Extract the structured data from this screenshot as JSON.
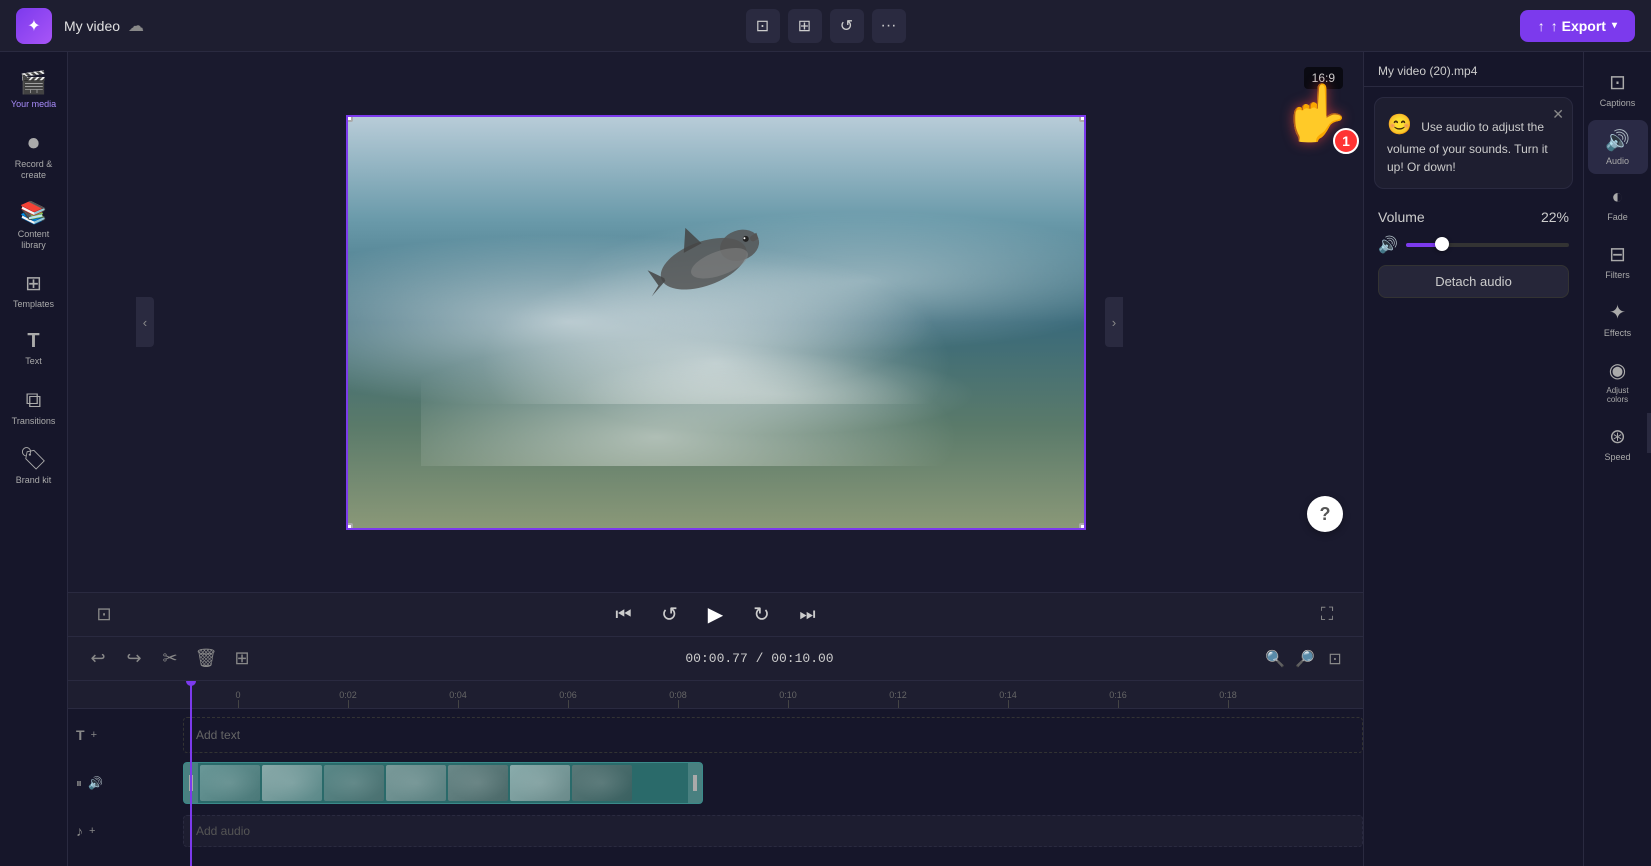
{
  "app": {
    "logo": "✦",
    "title": "My video",
    "file_name": "My video (20).mp4"
  },
  "toolbar": {
    "crop_label": "⊡",
    "frame_label": "⊞",
    "rotate_label": "↺",
    "more_label": "···",
    "export_label": "↑ Export",
    "aspect_ratio": "16:9"
  },
  "sidebar": {
    "items": [
      {
        "id": "your-media",
        "icon": "🎬",
        "label": "Your media"
      },
      {
        "id": "record",
        "icon": "⏺",
        "label": "Record &\ncreate"
      },
      {
        "id": "content-library",
        "icon": "📚",
        "label": "Content\nlibrary"
      },
      {
        "id": "templates",
        "icon": "⊞",
        "label": "Templates"
      },
      {
        "id": "text",
        "icon": "T",
        "label": "Text"
      },
      {
        "id": "transitions",
        "icon": "⧉",
        "label": "Transitions"
      },
      {
        "id": "brand",
        "icon": "🏷",
        "label": "Brand kit"
      }
    ]
  },
  "right_panel": {
    "file_name": "My video (20).mp4",
    "tooltip": {
      "emoji": "😊",
      "text": "Use audio to adjust the volume of your sounds. Turn it up! Or down!"
    },
    "volume": {
      "label": "Volume",
      "value": "22%",
      "percent": 22
    },
    "detach_button": "Detach audio"
  },
  "right_sidebar": {
    "items": [
      {
        "id": "captions",
        "icon": "⊡",
        "label": "Captions"
      },
      {
        "id": "audio",
        "icon": "🔊",
        "label": "Audio"
      },
      {
        "id": "fade",
        "icon": "◐",
        "label": "Fade"
      },
      {
        "id": "filters",
        "icon": "⊟",
        "label": "Filters"
      },
      {
        "id": "effects",
        "icon": "✦",
        "label": "Effects"
      },
      {
        "id": "adjust-colors",
        "icon": "◉",
        "label": "Adjust\ncolors"
      },
      {
        "id": "speed",
        "icon": "⊛",
        "label": "Speed"
      }
    ]
  },
  "timeline": {
    "time_current": "00:00.77",
    "time_total": "00:10.00",
    "time_display": "00:00.77 / 00:10.00",
    "ruler_marks": [
      "0",
      "0:02",
      "0:04",
      "0:06",
      "0:08",
      "0:10",
      "0:12",
      "0:14",
      "0:16",
      "0:18"
    ],
    "tracks": {
      "text_label": "T",
      "text_add": "Add text",
      "video_label": "🎬",
      "audio_label": "♪",
      "audio_add": "Add audio"
    }
  },
  "playback": {
    "skip_back": "⏮",
    "rewind": "↺",
    "play": "▶",
    "forward": "↻",
    "skip_forward": "⏭"
  }
}
